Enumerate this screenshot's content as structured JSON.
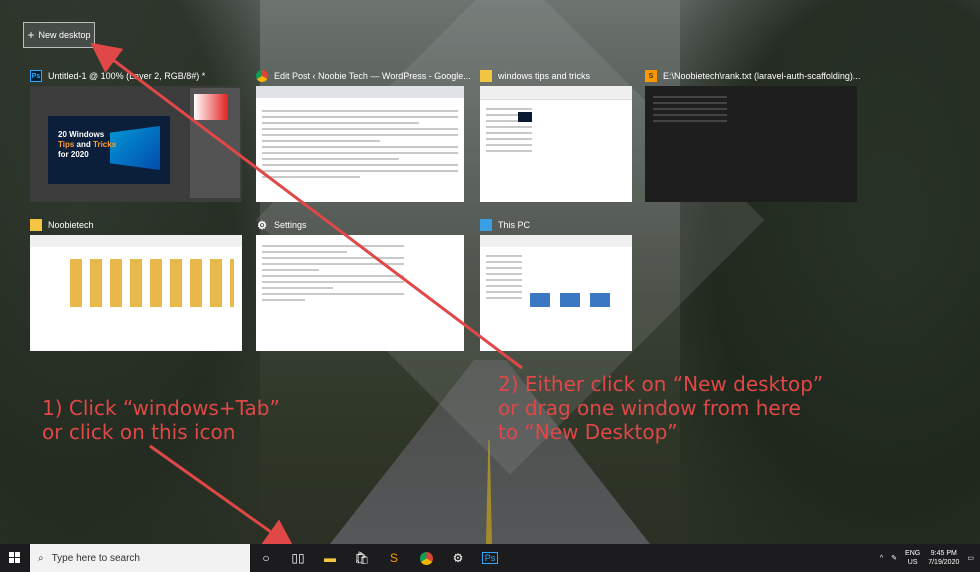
{
  "task_view": {
    "new_desktop_label": "New desktop",
    "windows": [
      {
        "title": "Untitled-1 @ 100% (Layer 2, RGB/8#) *",
        "app": "Ps"
      },
      {
        "title": "Edit Post ‹ Noobie Tech — WordPress - Google...",
        "app": "chrome"
      },
      {
        "title": "windows tips and tricks",
        "app": "folder"
      },
      {
        "title": "E:\\Noobietech\\rank.txt (laravel-auth-scaffolding)...",
        "app": "sublime"
      },
      {
        "title": "Noobietech",
        "app": "folder"
      },
      {
        "title": "Settings",
        "app": "gear"
      },
      {
        "title": "This PC",
        "app": "pc"
      }
    ],
    "ps_canvas_text": [
      "20 Windows",
      "Tips",
      "and",
      "Tricks",
      "for 2020"
    ]
  },
  "annotations": {
    "left": "1) Click “windows+Tab”\nor click on this icon",
    "right": "2) Either click on “New desktop”\nor drag one window from here\nto “New Desktop”"
  },
  "taskbar": {
    "search_placeholder": "Type here to search",
    "lang_top": "ENG",
    "lang_bottom": "US",
    "time": "9:45 PM",
    "date": "7/19/2020"
  },
  "colors": {
    "annotation": "#e04848",
    "taskbar": "#1c1c1e"
  }
}
